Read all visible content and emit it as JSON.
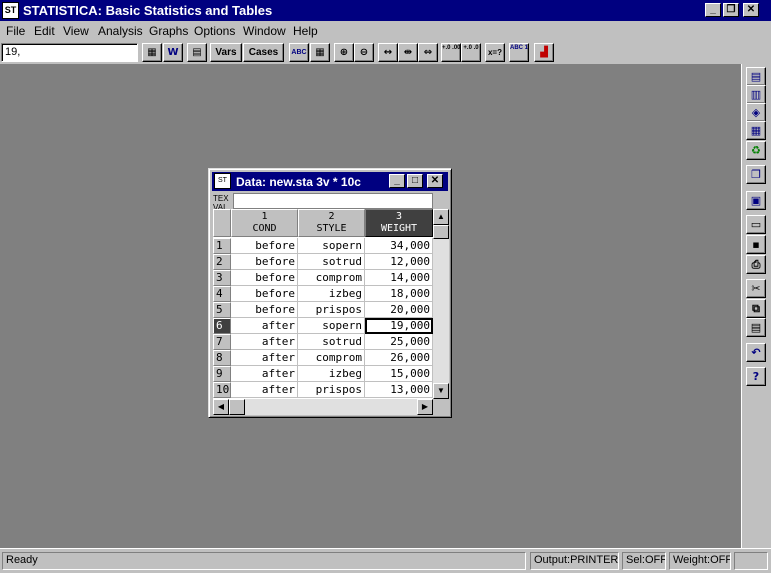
{
  "app": {
    "title": "STATISTICA: Basic Statistics and Tables",
    "icon_text": "ST",
    "caption_buttons": {
      "minimize": "_",
      "restore": "❐",
      "close": "✕"
    }
  },
  "menu": [
    "File",
    "Edit",
    "View",
    "Analysis",
    "Graphs",
    "Options",
    "Window",
    "Help"
  ],
  "toolbar": {
    "value_field": "19,",
    "vars_label": "Vars",
    "cases_label": "Cases",
    "decimal_more": "+.0 .00",
    "decimal_less": "+.0 .0",
    "xsq": "x=?",
    "abc123": "ABC 123"
  },
  "data_window": {
    "title": "Data: new.sta 3v * 10c",
    "icon_text": "ST",
    "header_label": "TEX VAL",
    "columns": [
      {
        "num": "1",
        "name": "COND"
      },
      {
        "num": "2",
        "name": "STYLE"
      },
      {
        "num": "3",
        "name": "WEIGHT"
      }
    ],
    "rows": [
      {
        "num": "1",
        "cond": "before",
        "style": "sopern",
        "weight": "34,000"
      },
      {
        "num": "2",
        "cond": "before",
        "style": "sotrud",
        "weight": "12,000"
      },
      {
        "num": "3",
        "cond": "before",
        "style": "comprom",
        "weight": "14,000"
      },
      {
        "num": "4",
        "cond": "before",
        "style": "izbeg",
        "weight": "18,000"
      },
      {
        "num": "5",
        "cond": "before",
        "style": "prispos",
        "weight": "20,000"
      },
      {
        "num": "6",
        "cond": "after",
        "style": "sopern",
        "weight": "19,000"
      },
      {
        "num": "7",
        "cond": "after",
        "style": "sotrud",
        "weight": "25,000"
      },
      {
        "num": "8",
        "cond": "after",
        "style": "comprom",
        "weight": "26,000"
      },
      {
        "num": "9",
        "cond": "after",
        "style": "izbeg",
        "weight": "15,000"
      },
      {
        "num": "10",
        "cond": "after",
        "style": "prispos",
        "weight": "13,000"
      }
    ]
  },
  "status": {
    "ready": "Ready",
    "output": "Output:PRINTER",
    "sel": "Sel:OFF",
    "weight": "Weight:OFF"
  },
  "colors": {
    "title_bar": "#000080",
    "workspace": "#808080",
    "face": "#c0c0c0"
  }
}
